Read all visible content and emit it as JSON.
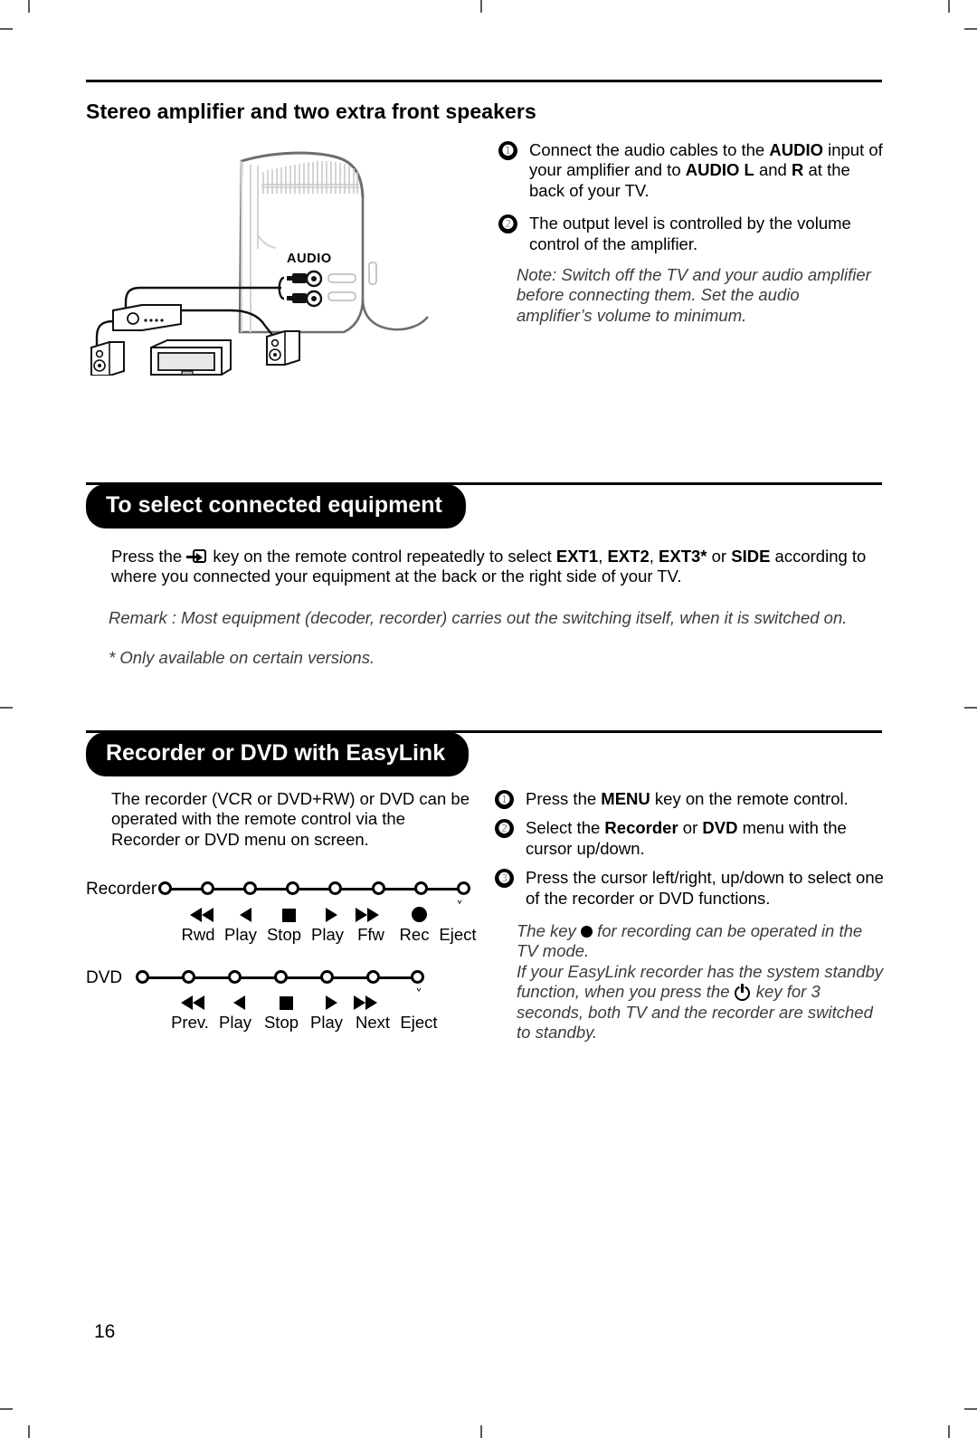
{
  "page": {
    "number": "16"
  },
  "section1": {
    "heading": "Stereo amplifier and two extra front speakers",
    "illustration": {
      "audio_label": "AUDIO",
      "name": "tv-rear-audio-connection-illustration"
    },
    "steps": [
      {
        "num": "❶",
        "parts": [
          {
            "t": "Connect the audio cables to the ",
            "b": false
          },
          {
            "t": "AUDIO",
            "b": true
          },
          {
            "t": " input of your amplifier and to ",
            "b": false
          },
          {
            "t": "AUDIO L",
            "b": true
          },
          {
            "t": " and ",
            "b": false
          },
          {
            "t": "R",
            "b": true
          },
          {
            "t": " at the back of your TV.",
            "b": false
          }
        ]
      },
      {
        "num": "❷",
        "parts": [
          {
            "t": "The output level is controlled by the volume control of the amplifier.",
            "b": false
          }
        ]
      }
    ],
    "note": "Note: Switch off the TV and your audio amplifier before connecting them. Set the audio amplifier’s volume to minimum."
  },
  "section2": {
    "heading": "To select connected equipment",
    "body": {
      "pre": "Press the ",
      "key_icon": "source-select-key-icon",
      "mid": " key on the remote control repeatedly to select ",
      "opt1": "EXT1",
      "sep1": ", ",
      "opt2": "EXT2",
      "sep2": ", ",
      "opt3": "EXT3*",
      "sep3": " or ",
      "opt4": "SIDE",
      "post": " according to where you connected your equipment at the back or the right side of your TV."
    },
    "remark": "Remark : Most equipment (decoder, recorder) carries out the switching itself, when it is switched on.",
    "footnote": "* Only available on certain versions."
  },
  "section3": {
    "heading": "Recorder or DVD with EasyLink",
    "intro": "The recorder (VCR or DVD+RW) or DVD can be operated with the remote control via the Recorder or DVD menu on screen.",
    "steps": [
      {
        "num": "❶",
        "parts": [
          {
            "t": "Press the ",
            "b": false
          },
          {
            "t": "MENU",
            "b": true
          },
          {
            "t": " key on the remote control.",
            "b": false
          }
        ]
      },
      {
        "num": "❷",
        "parts": [
          {
            "t": "Select the ",
            "b": false
          },
          {
            "t": "Recorder",
            "b": true
          },
          {
            "t": " or ",
            "b": false
          },
          {
            "t": "DVD",
            "b": true
          },
          {
            "t": " menu with the cursor up/down.",
            "b": false
          }
        ]
      },
      {
        "num": "❸",
        "parts": [
          {
            "t": "Press the cursor left/right, up/down to select one of the recorder or DVD functions.",
            "b": false
          }
        ]
      }
    ],
    "notes": {
      "line1_pre": "The key ",
      "line1_icon": "record-dot-icon",
      "line1_post": " for recording can be operated in the TV mode.",
      "line2_pre": "If your EasyLink recorder has the system standby function, when you press the ",
      "line2_icon": "power-standby-icon",
      "line2_post": " key for 3 seconds, both TV and the recorder are switched to standby."
    },
    "diagram": {
      "rows": [
        {
          "label": "Recorder",
          "node_count": 8,
          "functions": [
            {
              "icon": "rewind-icon",
              "label": "Rwd"
            },
            {
              "icon": "play-reverse-icon",
              "label": "Play"
            },
            {
              "icon": "stop-icon",
              "label": "Stop"
            },
            {
              "icon": "play-icon",
              "label": "Play"
            },
            {
              "icon": "fast-forward-icon",
              "label": "Ffw"
            },
            {
              "icon": "record-icon",
              "label": "Rec"
            },
            {
              "icon": "eject-icon",
              "label": "Eject"
            }
          ]
        },
        {
          "label": "DVD",
          "node_count": 7,
          "functions": [
            {
              "icon": "previous-icon",
              "label": "Prev."
            },
            {
              "icon": "play-reverse-icon",
              "label": "Play"
            },
            {
              "icon": "stop-icon",
              "label": "Stop"
            },
            {
              "icon": "play-icon",
              "label": "Play"
            },
            {
              "icon": "next-icon",
              "label": "Next"
            },
            {
              "icon": "eject-icon",
              "label": "Eject"
            }
          ]
        }
      ]
    }
  }
}
